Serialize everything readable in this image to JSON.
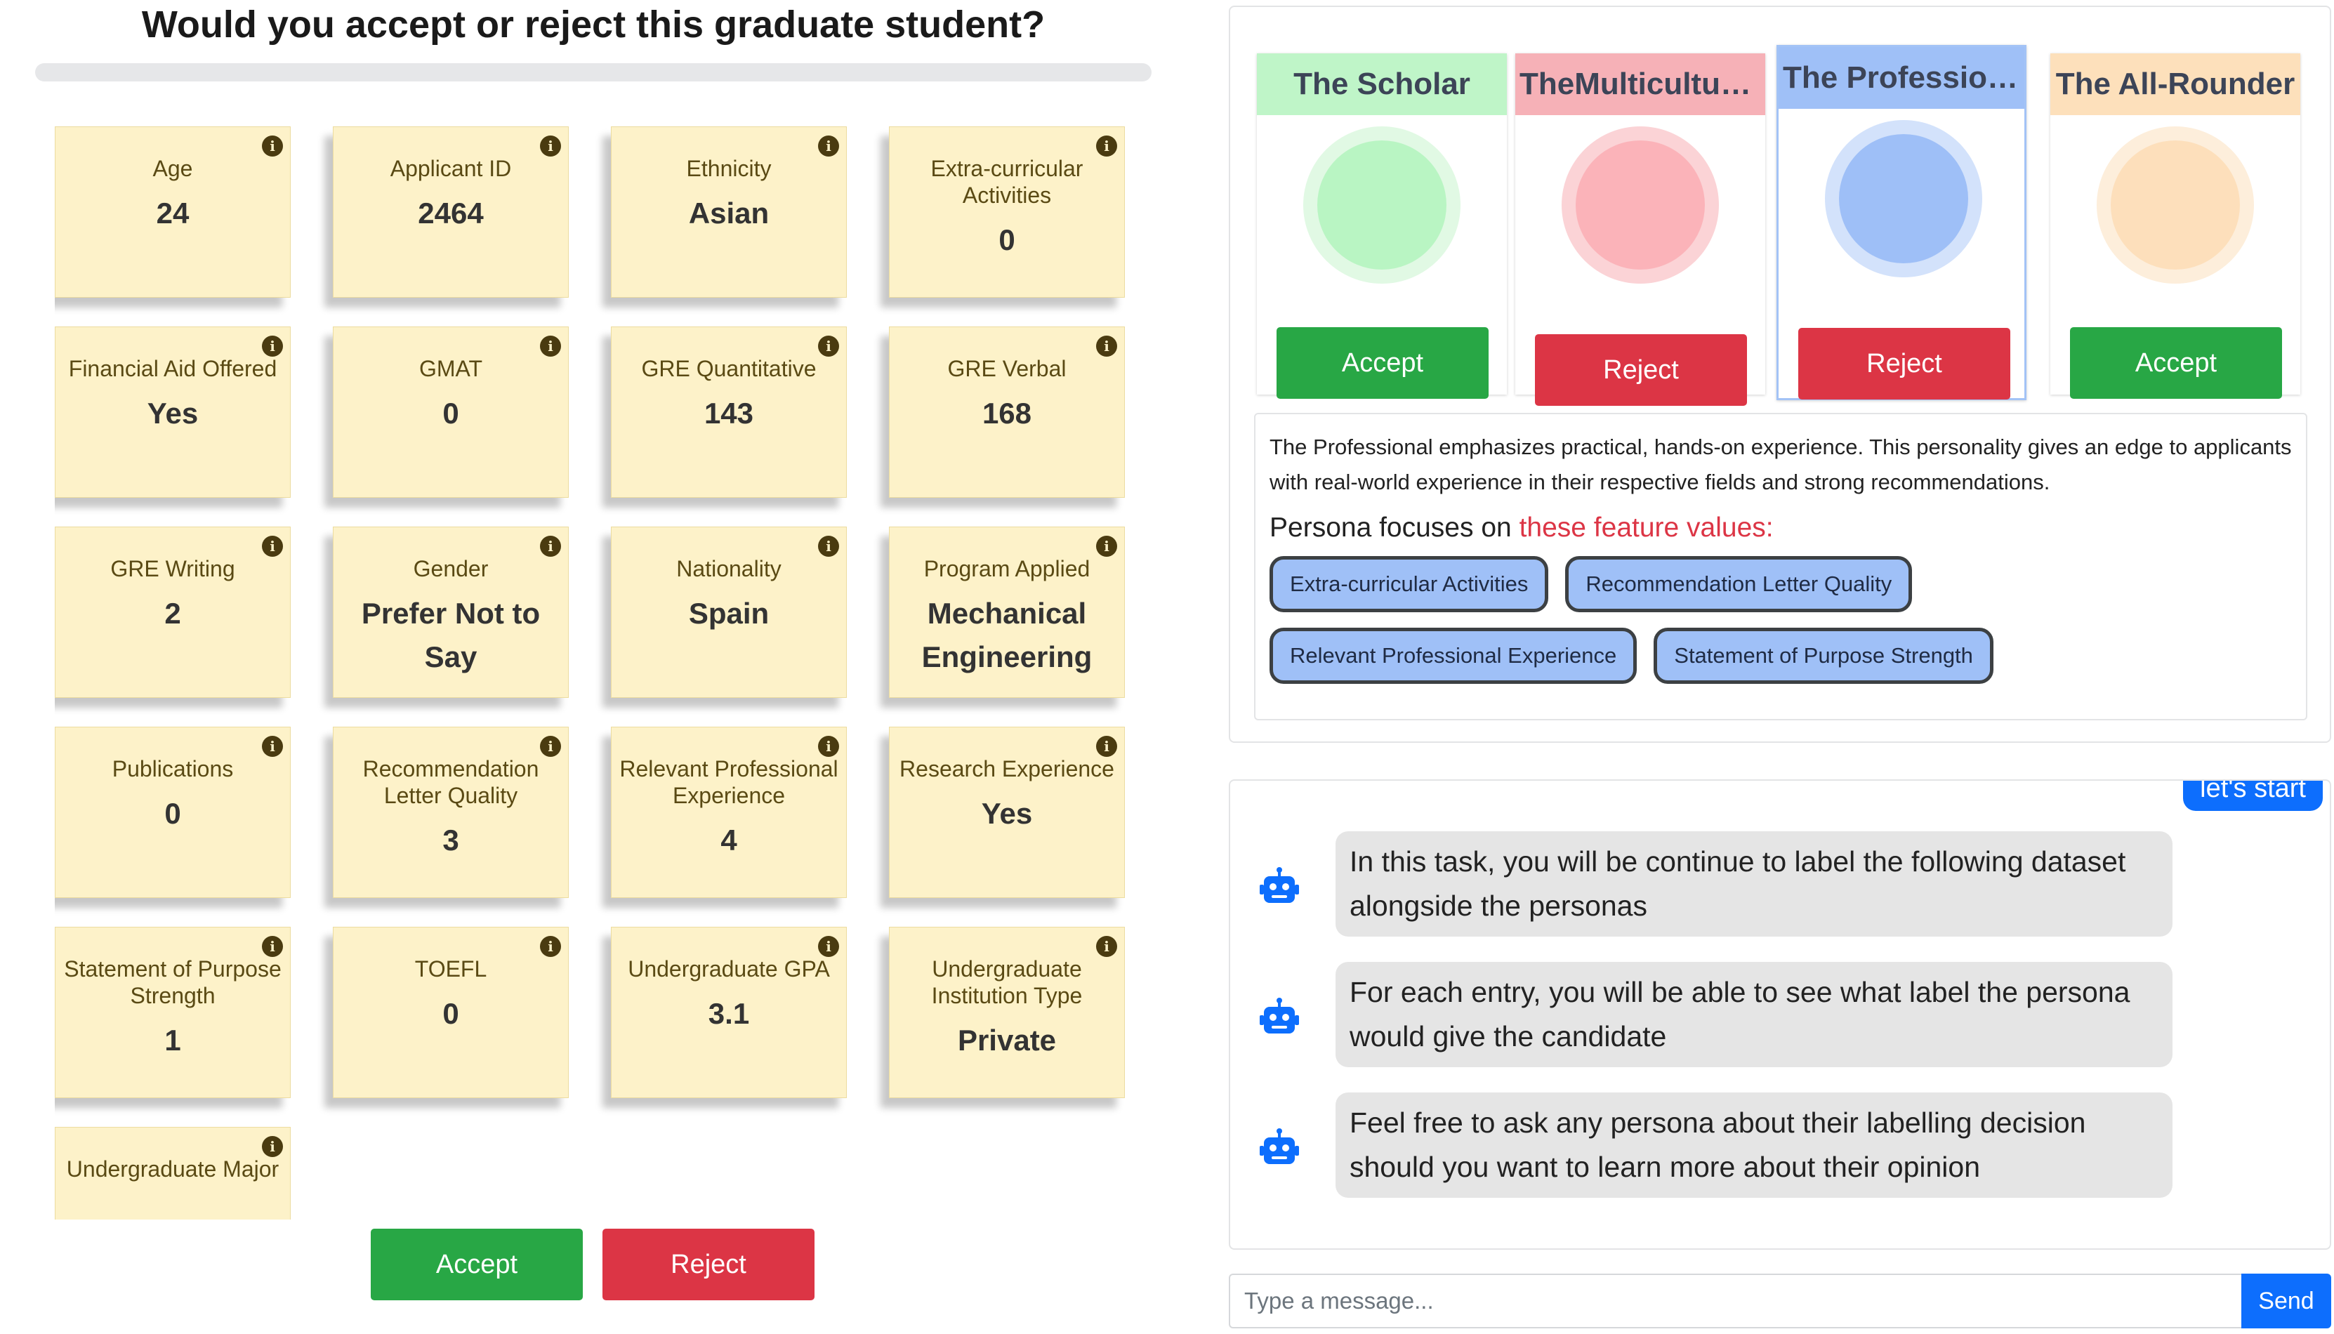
{
  "page": {
    "question": "Would you accept or reject this graduate student?",
    "progress_fraction": 0
  },
  "features": [
    {
      "label": "Age",
      "value": "24"
    },
    {
      "label": "Applicant ID",
      "value": "2464"
    },
    {
      "label": "Ethnicity",
      "value": "Asian"
    },
    {
      "label": "Extra-curricular Activities",
      "value": "0"
    },
    {
      "label": "Financial Aid Offered",
      "value": "Yes"
    },
    {
      "label": "GMAT",
      "value": "0"
    },
    {
      "label": "GRE Quantitative",
      "value": "143"
    },
    {
      "label": "GRE Verbal",
      "value": "168"
    },
    {
      "label": "GRE Writing",
      "value": "2"
    },
    {
      "label": "Gender",
      "value": "Prefer Not to Say"
    },
    {
      "label": "Nationality",
      "value": "Spain"
    },
    {
      "label": "Program Applied",
      "value": "Mechanical Engineering"
    },
    {
      "label": "Publications",
      "value": "0"
    },
    {
      "label": "Recommendation Letter Quality",
      "value": "3"
    },
    {
      "label": "Relevant Professional Experience",
      "value": "4"
    },
    {
      "label": "Research Experience",
      "value": "Yes"
    },
    {
      "label": "Statement of Purpose Strength",
      "value": "1"
    },
    {
      "label": "TOEFL",
      "value": "0"
    },
    {
      "label": "Undergraduate GPA",
      "value": "3.1"
    },
    {
      "label": "Undergraduate Institution Type",
      "value": "Private"
    },
    {
      "label": "Undergraduate Major",
      "value": ""
    }
  ],
  "info_icon_glyph": "i",
  "decision": {
    "accept_label": "Accept",
    "reject_label": "Reject"
  },
  "personas": [
    {
      "name": "The Scholar",
      "decision": "Accept",
      "header_color": "#bff5c8",
      "outer_color": "#e1f9e4",
      "inner_color": "#b9f5c3",
      "selected": false
    },
    {
      "name": "TheMulticultural Advocate",
      "decision": "Reject",
      "header_color": "#f6b1b7",
      "outer_color": "#fbd3d6",
      "inner_color": "#fbb3b9",
      "selected": false
    },
    {
      "name": "The Professional",
      "decision": "Reject",
      "header_color": "#9fc0f7",
      "outer_color": "#d3e2fb",
      "inner_color": "#9ebff7",
      "selected": true
    },
    {
      "name": "The All-Rounder",
      "decision": "Accept",
      "header_color": "#fde0bb",
      "outer_color": "#fdeedb",
      "inner_color": "#fddfbb",
      "selected": false
    }
  ],
  "persona_detail": {
    "description": "The Professional emphasizes practical, hands-on experience. This personality gives an edge to applicants with real-world experience in their respective fields and strong recommendations.",
    "focus_prefix": "Persona focuses on ",
    "focus_highlight": "these feature values:",
    "focus_features": [
      "Extra-curricular Activities",
      "Recommendation Letter Quality",
      "Relevant Professional Experience",
      "Statement of Purpose Strength"
    ]
  },
  "chat": {
    "user_message": "let's start",
    "bot_messages": [
      "In this task, you will be continue to label the following dataset alongside the personas",
      "For each entry, you will be able to see what label the persona would give the candidate",
      "Feel free to ask any persona about their labelling decision should you want to learn more about their opinion"
    ],
    "bot_icon": "robot-icon",
    "input_placeholder": "Type a message...",
    "send_label": "Send"
  },
  "colors": {
    "accept": "#28a745",
    "reject": "#dc3545",
    "primary": "#0d6efd",
    "card_bg": "#fdf2c9",
    "chip_bg": "#9fc0f7"
  }
}
